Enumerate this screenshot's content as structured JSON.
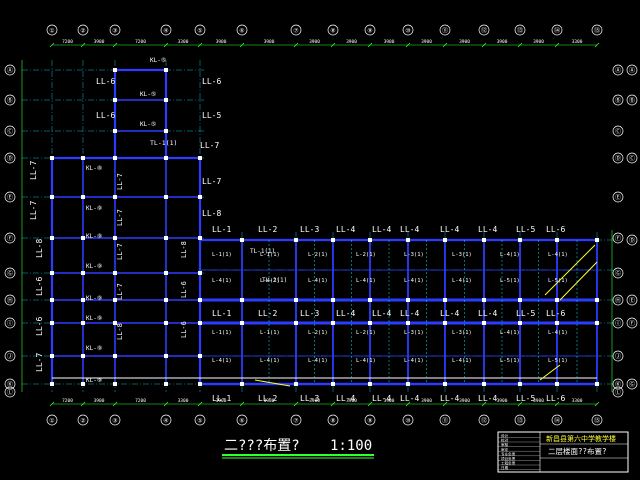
{
  "colors": {
    "background": "#000000",
    "grid_axis": "#00e5ff",
    "beam": "#2a3cff",
    "member_label": "#ffffff",
    "beam_label": "#33ff33",
    "dimension": "#33ff33",
    "highlight": "#ffff33",
    "title_rule": "#33ff33"
  },
  "top_axes": [
    "①",
    "②",
    "③",
    "④",
    "⑤",
    "⑥",
    "⑦",
    "⑧",
    "⑨",
    "⑩",
    "⑪",
    "⑫",
    "⑬",
    "⑭",
    "⑮"
  ],
  "bottom_axes": [
    "①",
    "②",
    "③",
    "④",
    "⑤",
    "⑥",
    "⑦",
    "⑧",
    "⑨",
    "⑩",
    "⑪",
    "⑫",
    "⑬",
    "⑭",
    "⑮"
  ],
  "left_axes": [
    "Ⓐ",
    "Ⓑ",
    "Ⓒ",
    "Ⓓ",
    "Ⓔ",
    "Ⓕ",
    "Ⓖ",
    "Ⓗ",
    "Ⓘ",
    "Ⓙ",
    "Ⓚ",
    "Ⓛ"
  ],
  "right_axes": [
    "Ⓐ",
    "Ⓑ",
    "Ⓒ",
    "Ⓓ",
    "Ⓔ",
    "Ⓕ",
    "Ⓖ"
  ],
  "top_dims": [
    "7200",
    "3900",
    "7200",
    "3300",
    "3900",
    "3900",
    "3900",
    "3900",
    "3900",
    "3900",
    "3900",
    "3900",
    "3900",
    "3300"
  ],
  "bottom_dims": [
    "7200",
    "3900",
    "7200",
    "3300",
    "3900",
    "3900",
    "3900",
    "3900",
    "3900",
    "3900",
    "3900",
    "3900",
    "3900",
    "3300"
  ],
  "west_wing_labels": [
    {
      "text": "LL-6",
      "kind": "wall"
    },
    {
      "text": "LL-6",
      "kind": "wall"
    },
    {
      "text": "LL-6",
      "kind": "wall"
    },
    {
      "text": "LL-5",
      "kind": "wall"
    },
    {
      "text": "LL-7",
      "kind": "wall"
    },
    {
      "text": "LL-7",
      "kind": "wall"
    },
    {
      "text": "LL-7",
      "kind": "wall"
    },
    {
      "text": "LL-7",
      "kind": "wall"
    },
    {
      "text": "LL-8",
      "kind": "wall"
    },
    {
      "text": "LL-8",
      "kind": "wall"
    },
    {
      "text": "LL-6",
      "kind": "wall"
    },
    {
      "text": "LL-6",
      "kind": "wall"
    },
    {
      "text": "LL-7",
      "kind": "wall"
    }
  ],
  "kl_labels": [
    "KL-⑤",
    "KL-⑤",
    "KL-⑤",
    "KL-⑧",
    "KL-⑨",
    "KL-⑨",
    "KL-⑨",
    "KL-⑨",
    "KL-⑨",
    "KL-⑨",
    "KL-⑨"
  ],
  "tl_labels": [
    "TL-1(1)",
    "TL-2(1)"
  ],
  "east_top_labels": [
    "LL-1",
    "LL-2",
    "LL-3",
    "LL-4",
    "LL-4",
    "LL-4",
    "LL-4",
    "LL-4",
    "LL-5",
    "LL-6"
  ],
  "east_mid_labels": [
    "LL-1",
    "LL-2",
    "LL-3",
    "LL-4",
    "LL-4",
    "LL-4",
    "LL-4",
    "LL-4",
    "LL-5",
    "LL-6"
  ],
  "east_bot_labels": [
    "LL-1",
    "LL-2",
    "LL-3",
    "LL-4",
    "LL-4",
    "LL-4",
    "LL-4",
    "LL-4",
    "LL-5",
    "LL-6"
  ],
  "l_beams_upper": [
    "L-1(1)",
    "L-1(1)",
    "L-2(1)",
    "L-2(1)",
    "L-3(1)",
    "L-3(1)",
    "L-4(1)",
    "L-4(1)",
    "L-4(1)",
    "L-4(1)",
    "L-4(1)",
    "L-4(1)",
    "L-4(1)",
    "L-4(1)",
    "L-5(1)",
    "L-5(1)"
  ],
  "l_beams_lower": [
    "L-1(1)",
    "L-1(1)",
    "L-2(1)",
    "L-2(1)",
    "L-3(1)",
    "L-3(1)",
    "L-4(1)",
    "L-4(1)",
    "L-4(1)",
    "L-4(1)",
    "L-4(1)",
    "L-4(1)",
    "L-4(1)",
    "L-4(1)",
    "L-5(1)",
    "L-5(1)"
  ],
  "drawing_title": "二???布置?",
  "scale": "1:100",
  "title_block": {
    "project": "新昌县第六中学教学楼",
    "sheet": "二层楼面??布置?",
    "rows": [
      "设计",
      "校对",
      "审核",
      "审定",
      "专业负责",
      "项目负责",
      "工程负责",
      "日期"
    ]
  }
}
